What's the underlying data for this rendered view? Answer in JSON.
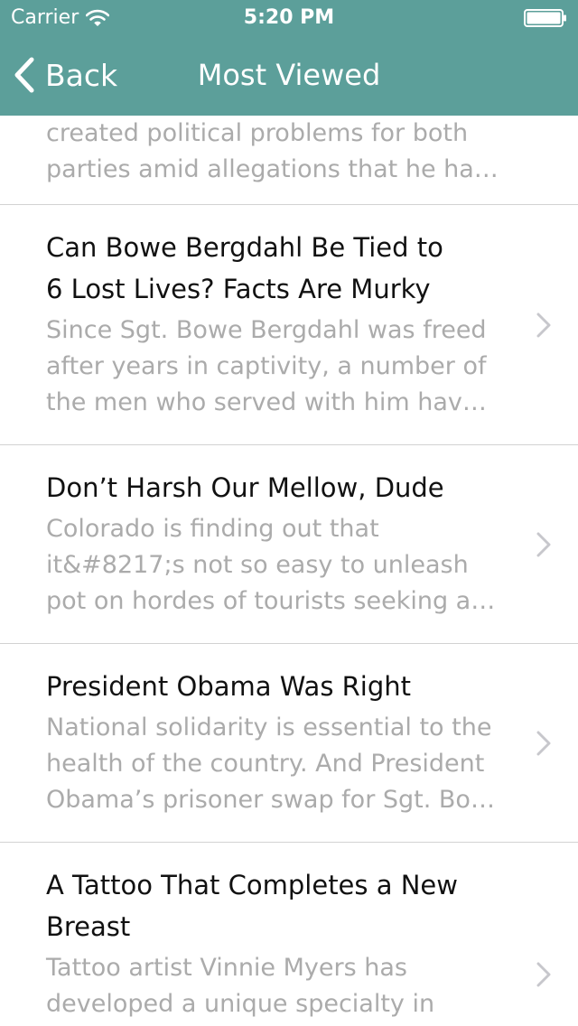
{
  "status_bar": {
    "carrier": "Carrier",
    "time": "5:20 PM"
  },
  "nav": {
    "back_label": "Back",
    "title": "Most Viewed"
  },
  "colors": {
    "header_bg": "#5c9f9a",
    "title_text": "#111111",
    "summary_text": "#ababab",
    "separator": "#d2d2d2"
  },
  "articles": [
    {
      "summary": "created political problems for both\nparties amid allegations that he ha…"
    },
    {
      "title": "Can Bowe Bergdahl Be Tied to\n6 Lost Lives? Facts Are Murky",
      "summary": "Since Sgt. Bowe Bergdahl was freed\nafter years in captivity, a number of\nthe men who served with him hav…"
    },
    {
      "title": "Don’t Harsh Our Mellow, Dude",
      "summary": "Colorado is finding out that\nit&#8217;s not so easy to unleash\npot on hordes of tourists seeking a…"
    },
    {
      "title": "President Obama Was Right",
      "summary": "National solidarity is essential to the\nhealth of the country. And President\nObama’s prisoner swap for Sgt. Bo…"
    },
    {
      "title": "A Tattoo That Completes a New\nBreast",
      "summary": "Tattoo artist Vinnie Myers has\ndeveloped a unique specialty in"
    }
  ]
}
